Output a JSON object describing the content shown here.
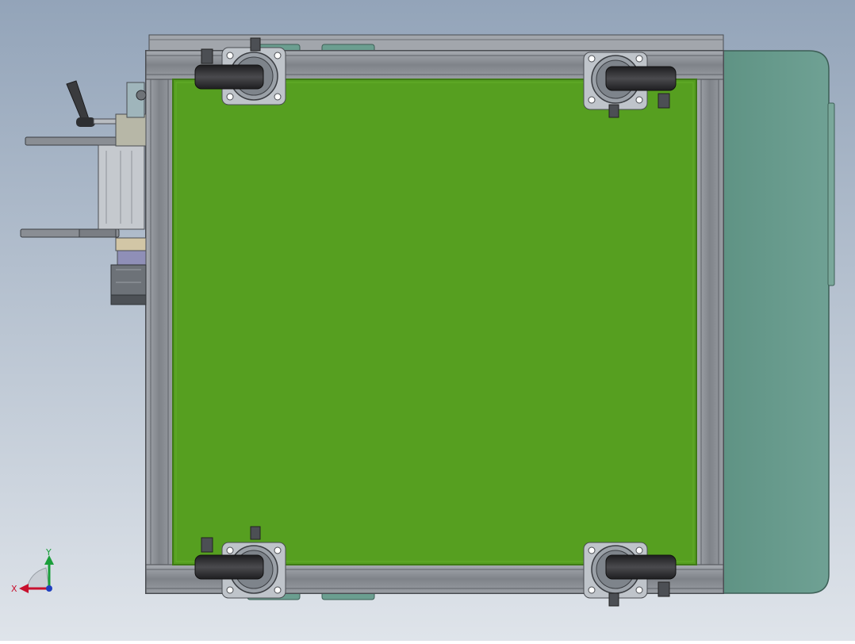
{
  "viewport": {
    "background_top": "#93a4b9",
    "background_bottom": "#dfe4ea"
  },
  "colors": {
    "frame": "#8b8f95",
    "frame_dark": "#4a4d52",
    "panel": "#569f20",
    "panel_edge": "#3f7a16",
    "side_cover": "#6b9e90",
    "side_cover_edge": "#3d5f56",
    "wheel": "#2b2b2d",
    "plate": "#b9bec5",
    "axis_x": "#c8102e",
    "axis_y": "#1a9e3a",
    "axis_z": "#1f3fbf"
  },
  "triad": {
    "x_label": "X",
    "y_label": "Y"
  }
}
